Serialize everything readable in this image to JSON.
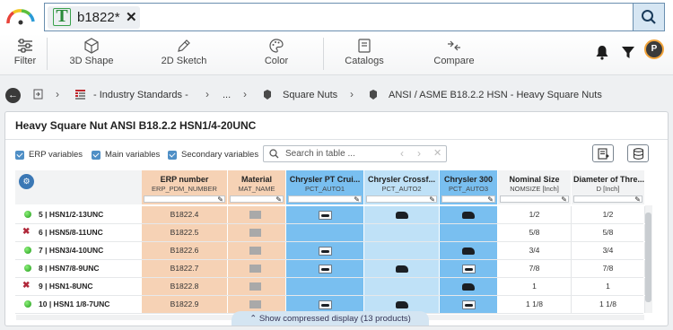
{
  "search": {
    "query": "b1822*",
    "chip_icon": "T"
  },
  "toolbar": {
    "filter": "Filter",
    "shape3d": "3D Shape",
    "sketch2d": "2D Sketch",
    "color": "Color",
    "catalogs": "Catalogs",
    "compare": "Compare"
  },
  "breadcrumb": {
    "items": [
      "- Industry Standards -",
      "...",
      "Square Nuts",
      "ANSI / ASME B18.2.2 HSN - Heavy Square Nuts"
    ]
  },
  "panel": {
    "title": "Heavy Square Nut ANSI B18.2.2 HSN1/4-20UNC",
    "options": [
      "ERP variables",
      "Main variables",
      "Secondary variables"
    ],
    "search_placeholder": "Search in table ...",
    "compress_label": "Show compressed display (13 products)"
  },
  "columns": [
    {
      "title": "ERP number",
      "sub": "ERP_PDM_NUMBER",
      "color": "#f6d2b5"
    },
    {
      "title": "Material",
      "sub": "MAT_NAME",
      "color": "#f6d2b5"
    },
    {
      "title": "Chrysler PT Crui...",
      "sub": "PCT_AUTO1",
      "color": "#79bff0"
    },
    {
      "title": "Chrysler Crossf...",
      "sub": "PCT_AUTO2",
      "color": "#bfe1f7"
    },
    {
      "title": "Chrysler 300",
      "sub": "PCT_AUTO3",
      "color": "#79bff0"
    },
    {
      "title": "Nominal Size",
      "sub": "NOMSIZE [Inch]",
      "color": "#f2f3f4"
    },
    {
      "title": "Diameter of Thre...",
      "sub": "D [Inch]",
      "color": "#f2f3f4"
    }
  ],
  "rows": [
    {
      "label": "5 | HSN1/2-13UNC",
      "status": "ok",
      "erp": "B1822.4",
      "a1": "boxed",
      "a2": "car",
      "a3": "car",
      "nom": "1/2",
      "d": "1/2"
    },
    {
      "label": "6 | HSN5/8-11UNC",
      "status": "bad",
      "erp": "B1822.5",
      "a1": "",
      "a2": "",
      "a3": "",
      "nom": "5/8",
      "d": "5/8"
    },
    {
      "label": "7 | HSN3/4-10UNC",
      "status": "ok",
      "erp": "B1822.6",
      "a1": "boxed",
      "a2": "",
      "a3": "car",
      "nom": "3/4",
      "d": "3/4"
    },
    {
      "label": "8 | HSN7/8-9UNC",
      "status": "ok",
      "erp": "B1822.7",
      "a1": "boxed",
      "a2": "car",
      "a3": "boxed",
      "nom": "7/8",
      "d": "7/8"
    },
    {
      "label": "9 | HSN1-8UNC",
      "status": "bad",
      "erp": "B1822.8",
      "a1": "",
      "a2": "",
      "a3": "car",
      "nom": "1",
      "d": "1"
    },
    {
      "label": "10 | HSN1 1/8-7UNC",
      "status": "ok",
      "erp": "B1822.9",
      "a1": "boxed",
      "a2": "car",
      "a3": "boxed",
      "nom": "1 1/8",
      "d": "1 1/8"
    }
  ]
}
